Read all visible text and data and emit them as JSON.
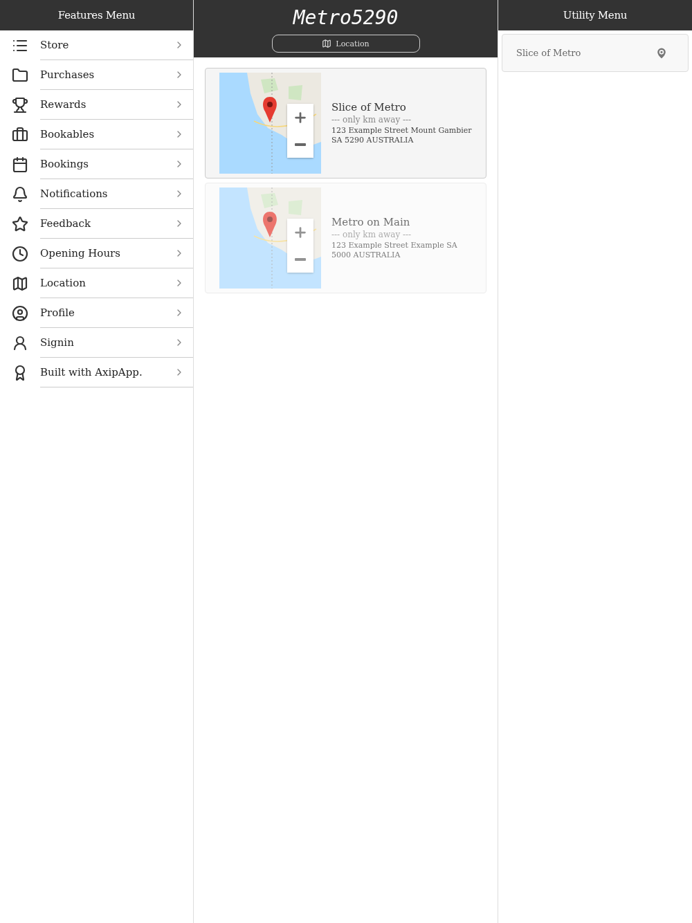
{
  "features_menu": {
    "title": "Features Menu",
    "items": [
      {
        "label": "Store"
      },
      {
        "label": "Purchases"
      },
      {
        "label": "Rewards"
      },
      {
        "label": "Bookables"
      },
      {
        "label": "Bookings"
      },
      {
        "label": "Notifications"
      },
      {
        "label": "Feedback"
      },
      {
        "label": "Opening Hours"
      },
      {
        "label": "Location"
      },
      {
        "label": "Profile"
      },
      {
        "label": "Signin"
      },
      {
        "label": "Built with AxipApp."
      }
    ]
  },
  "main": {
    "title": "Metro5290",
    "location_button": "Location",
    "locations": [
      {
        "name": "Slice of Metro",
        "distance": "--- only km away ---",
        "address": "123 Example Street Mount Gambier SA 5290 AUSTRALIA",
        "selected": true
      },
      {
        "name": "Metro on Main",
        "distance": "--- only km away ---",
        "address": "123 Example Street Example SA 5000 AUSTRALIA",
        "selected": false
      }
    ]
  },
  "utility_menu": {
    "title": "Utility Menu",
    "location": "Slice of Metro"
  }
}
